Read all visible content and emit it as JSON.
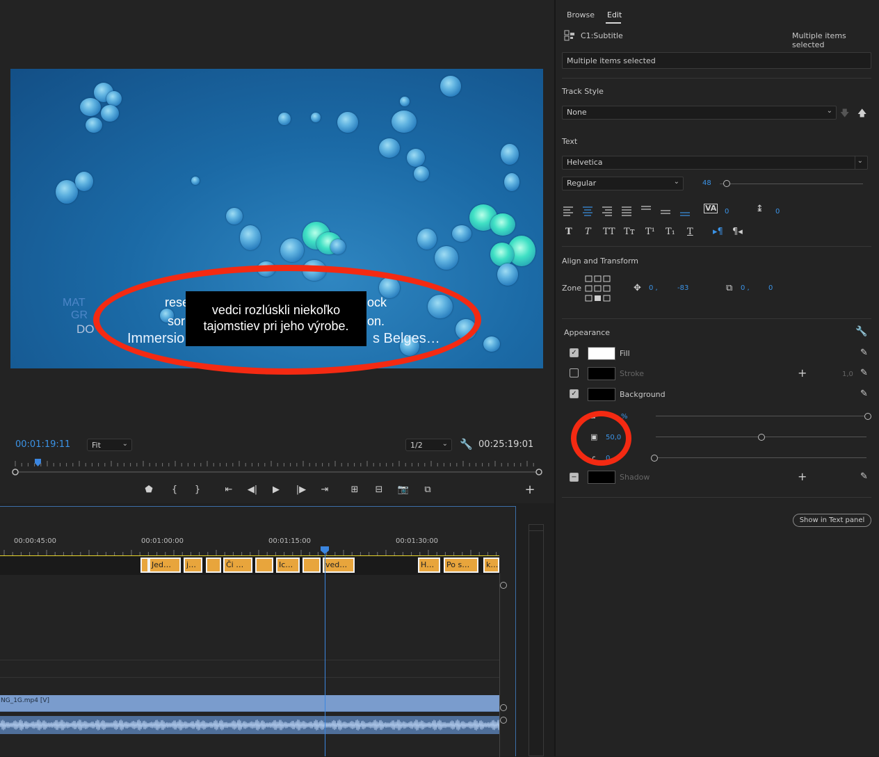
{
  "subtitles_overlay": {
    "left_fragment_1": "rese",
    "left_fragment_2": "sor",
    "left_fragment_3": "Immersio",
    "right_fragment_1": "ock",
    "right_fragment_2": "on.",
    "right_fragment_3": "s Belges…",
    "box_line_1": "vedci rozlúskli niekoľko",
    "box_line_2": "tajomstiev pri jeho výrobe.",
    "logo_text_1": "MAT",
    "logo_text_2": "GR",
    "logo_text_3": "DO"
  },
  "monitor": {
    "current_timecode": "00:01:19:11",
    "fit_label": "Fit",
    "resolution_label": "1/2",
    "duration_timecode": "00:25:19:01"
  },
  "timeline": {
    "ruler": [
      "00:00:45:00",
      "00:01:00:00",
      "00:01:15:00",
      "00:01:30:00"
    ],
    "clips": [
      "Jed…",
      "j…",
      "Či …",
      "Ic…",
      "ved…",
      "H…",
      "Po s…",
      "k…"
    ],
    "video_clip": "NG_1G.mp4 [V]"
  },
  "panel": {
    "tabs": [
      "Browse",
      "Edit"
    ],
    "active_tab": "Edit",
    "clip_name": "C1:Subtitle",
    "selection_status": "Multiple items selected",
    "text_field": "Multiple items selected",
    "track_style_label": "Track Style",
    "track_style_value": "None",
    "text_label": "Text",
    "font": "Helvetica",
    "font_style": "Regular",
    "font_size": "48",
    "font_size_fraction": 0.05,
    "kerning": "0",
    "leading": "0",
    "align_transform_label": "Align and Transform",
    "zone_label": "Zone",
    "position_x": "0 ,",
    "position_y": "-83",
    "scale_x": "0 ,",
    "scale_y": "0",
    "appearance_label": "Appearance",
    "fill_label": "Fill",
    "stroke_label": "Stroke",
    "stroke_width": "1,0",
    "background_label": "Background",
    "bg_opacity_unit": "%",
    "bg_size": "50,0",
    "bg_size_fraction": 0.5,
    "bg_radius": "0",
    "shadow_label": "Shadow",
    "show_in_text_panel": "Show in Text panel",
    "fill_color": "#ffffff",
    "stroke_color": "#000000",
    "background_color": "#000000",
    "shadow_color": "#000000"
  },
  "colors": {
    "accent": "#3b93e6",
    "annotation": "#f42a12",
    "clip": "#e8a53c",
    "playhead": "#3b86e0"
  }
}
